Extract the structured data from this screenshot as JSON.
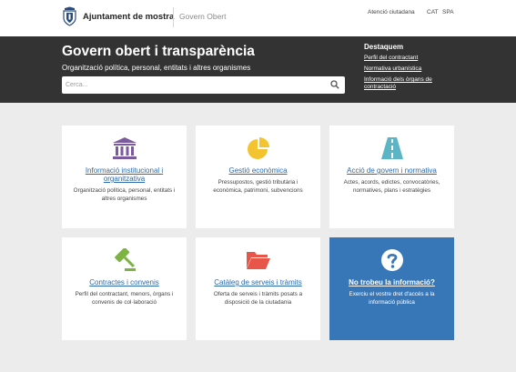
{
  "header": {
    "brand_name": "Ajuntament de mostra",
    "section_name": "Govern Obert",
    "links": {
      "atencio": "Atenció ciutadana",
      "cat": "CAT",
      "spa": "SPA"
    }
  },
  "banner": {
    "title": "Govern obert i transparència",
    "subtitle": "Organització política, personal, entitats i altres organismes",
    "search_placeholder": "Cerca...",
    "highlights_title": "Destaquem",
    "highlights": [
      "Perfil del contractant",
      "Normativa urbanística",
      "Informació dels òrgans de contractació"
    ]
  },
  "cards": [
    {
      "icon": "institution-icon",
      "title": "Informació institucional i organitzativa",
      "desc": "Organització política, personal, entitats i altres organismes"
    },
    {
      "icon": "pie-chart-icon",
      "title": "Gestió econòmica",
      "desc": "Pressupostos, gestió tributària i econòmica, patrimoni, subvencions"
    },
    {
      "icon": "road-icon",
      "title": "Acció de govern i normativa",
      "desc": "Actes, acords, edictes, convocatòries, normatives, plans i estratègies"
    },
    {
      "icon": "gavel-icon",
      "title": "Contractes i convenis",
      "desc": "Perfil del contractant, menors, òrgans i convenis de col·laboració"
    },
    {
      "icon": "folder-open-icon",
      "title": "Catàleg de serveis i tràmits",
      "desc": "Oferta de serveis i tràmits posats a disposició de la ciutadania"
    },
    {
      "icon": "question-icon",
      "title": "No trobeu la informació?",
      "desc": "Exerciu el vostre dret d'accés a la informació pública"
    }
  ],
  "colors": {
    "banner": "#333333",
    "accent_blue": "#3777b7",
    "link_blue": "#2c6aa8",
    "icon_purple": "#7b5a9e",
    "icon_yellow": "#f4c430",
    "icon_teal": "#5bb5c5",
    "icon_green": "#7cb342",
    "icon_red": "#e8564a"
  }
}
